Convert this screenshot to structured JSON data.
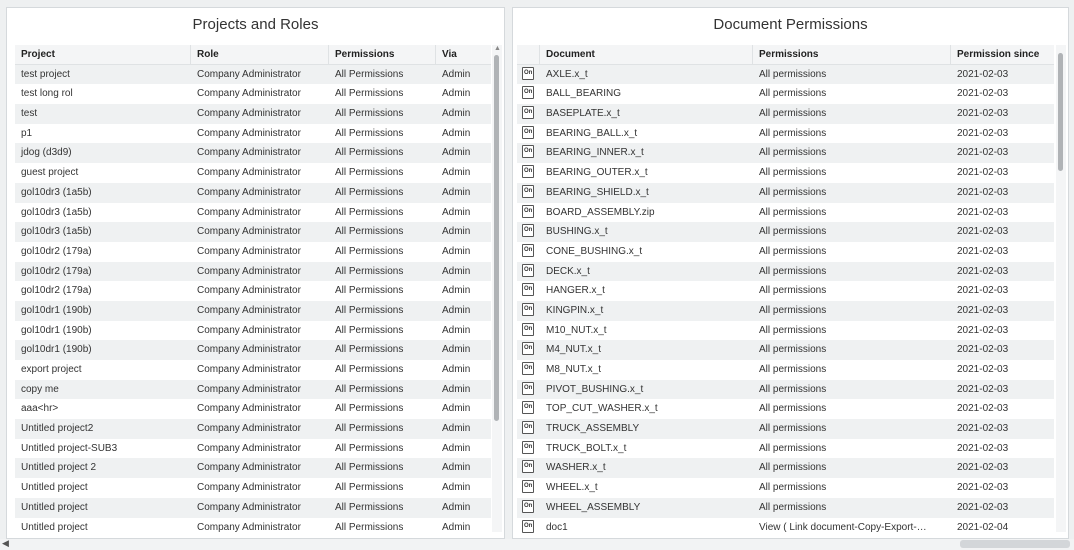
{
  "projects_panel": {
    "title": "Projects and Roles",
    "columns": [
      "Project",
      "Role",
      "Permissions",
      "Via"
    ],
    "rows": [
      [
        "test project",
        "Company Administrator",
        "All Permissions",
        "Admin"
      ],
      [
        "test long rol",
        "Company Administrator",
        "All Permissions",
        "Admin"
      ],
      [
        "test",
        "Company Administrator",
        "All Permissions",
        "Admin"
      ],
      [
        "p1",
        "Company Administrator",
        "All Permissions",
        "Admin"
      ],
      [
        "jdog (d3d9)",
        "Company Administrator",
        "All Permissions",
        "Admin"
      ],
      [
        "guest project",
        "Company Administrator",
        "All Permissions",
        "Admin"
      ],
      [
        "gol10dr3 (1a5b)",
        "Company Administrator",
        "All Permissions",
        "Admin"
      ],
      [
        "gol10dr3 (1a5b)",
        "Company Administrator",
        "All Permissions",
        "Admin"
      ],
      [
        "gol10dr3 (1a5b)",
        "Company Administrator",
        "All Permissions",
        "Admin"
      ],
      [
        "gol10dr2 (179a)",
        "Company Administrator",
        "All Permissions",
        "Admin"
      ],
      [
        "gol10dr2 (179a)",
        "Company Administrator",
        "All Permissions",
        "Admin"
      ],
      [
        "gol10dr2 (179a)",
        "Company Administrator",
        "All Permissions",
        "Admin"
      ],
      [
        "gol10dr1 (190b)",
        "Company Administrator",
        "All Permissions",
        "Admin"
      ],
      [
        "gol10dr1 (190b)",
        "Company Administrator",
        "All Permissions",
        "Admin"
      ],
      [
        "gol10dr1 (190b)",
        "Company Administrator",
        "All Permissions",
        "Admin"
      ],
      [
        "export project",
        "Company Administrator",
        "All Permissions",
        "Admin"
      ],
      [
        "copy me",
        "Company Administrator",
        "All Permissions",
        "Admin"
      ],
      [
        "aaa<hr>",
        "Company Administrator",
        "All Permissions",
        "Admin"
      ],
      [
        "Untitled project2",
        "Company Administrator",
        "All Permissions",
        "Admin"
      ],
      [
        "Untitled project-SUB3",
        "Company Administrator",
        "All Permissions",
        "Admin"
      ],
      [
        "Untitled project 2",
        "Company Administrator",
        "All Permissions",
        "Admin"
      ],
      [
        "Untitled project",
        "Company Administrator",
        "All Permissions",
        "Admin"
      ],
      [
        "Untitled project",
        "Company Administrator",
        "All Permissions",
        "Admin"
      ],
      [
        "Untitled project",
        "Company Administrator",
        "All Permissions",
        "Admin"
      ]
    ]
  },
  "documents_panel": {
    "title": "Document Permissions",
    "columns": [
      "",
      "Document",
      "Permissions",
      "Permission since"
    ],
    "rows": [
      [
        "AXLE.x_t",
        "All permissions",
        "2021-02-03"
      ],
      [
        "BALL_BEARING",
        "All permissions",
        "2021-02-03"
      ],
      [
        "BASEPLATE.x_t",
        "All permissions",
        "2021-02-03"
      ],
      [
        "BEARING_BALL.x_t",
        "All permissions",
        "2021-02-03"
      ],
      [
        "BEARING_INNER.x_t",
        "All permissions",
        "2021-02-03"
      ],
      [
        "BEARING_OUTER.x_t",
        "All permissions",
        "2021-02-03"
      ],
      [
        "BEARING_SHIELD.x_t",
        "All permissions",
        "2021-02-03"
      ],
      [
        "BOARD_ASSEMBLY.zip",
        "All permissions",
        "2021-02-03"
      ],
      [
        "BUSHING.x_t",
        "All permissions",
        "2021-02-03"
      ],
      [
        "CONE_BUSHING.x_t",
        "All permissions",
        "2021-02-03"
      ],
      [
        "DECK.x_t",
        "All permissions",
        "2021-02-03"
      ],
      [
        "HANGER.x_t",
        "All permissions",
        "2021-02-03"
      ],
      [
        "KINGPIN.x_t",
        "All permissions",
        "2021-02-03"
      ],
      [
        "M10_NUT.x_t",
        "All permissions",
        "2021-02-03"
      ],
      [
        "M4_NUT.x_t",
        "All permissions",
        "2021-02-03"
      ],
      [
        "M8_NUT.x_t",
        "All permissions",
        "2021-02-03"
      ],
      [
        "PIVOT_BUSHING.x_t",
        "All permissions",
        "2021-02-03"
      ],
      [
        "TOP_CUT_WASHER.x_t",
        "All permissions",
        "2021-02-03"
      ],
      [
        "TRUCK_ASSEMBLY",
        "All permissions",
        "2021-02-03"
      ],
      [
        "TRUCK_BOLT.x_t",
        "All permissions",
        "2021-02-03"
      ],
      [
        "WASHER.x_t",
        "All permissions",
        "2021-02-03"
      ],
      [
        "WHEEL.x_t",
        "All permissions",
        "2021-02-03"
      ],
      [
        "WHEEL_ASSEMBLY",
        "All permissions",
        "2021-02-03"
      ],
      [
        "doc1",
        "View ( Link document-Copy-Export-…",
        "2021-02-04"
      ]
    ]
  },
  "icons": {
    "document_icon": "onshape-document-icon",
    "scroll_up": "▲",
    "scroll_left": "◀"
  }
}
